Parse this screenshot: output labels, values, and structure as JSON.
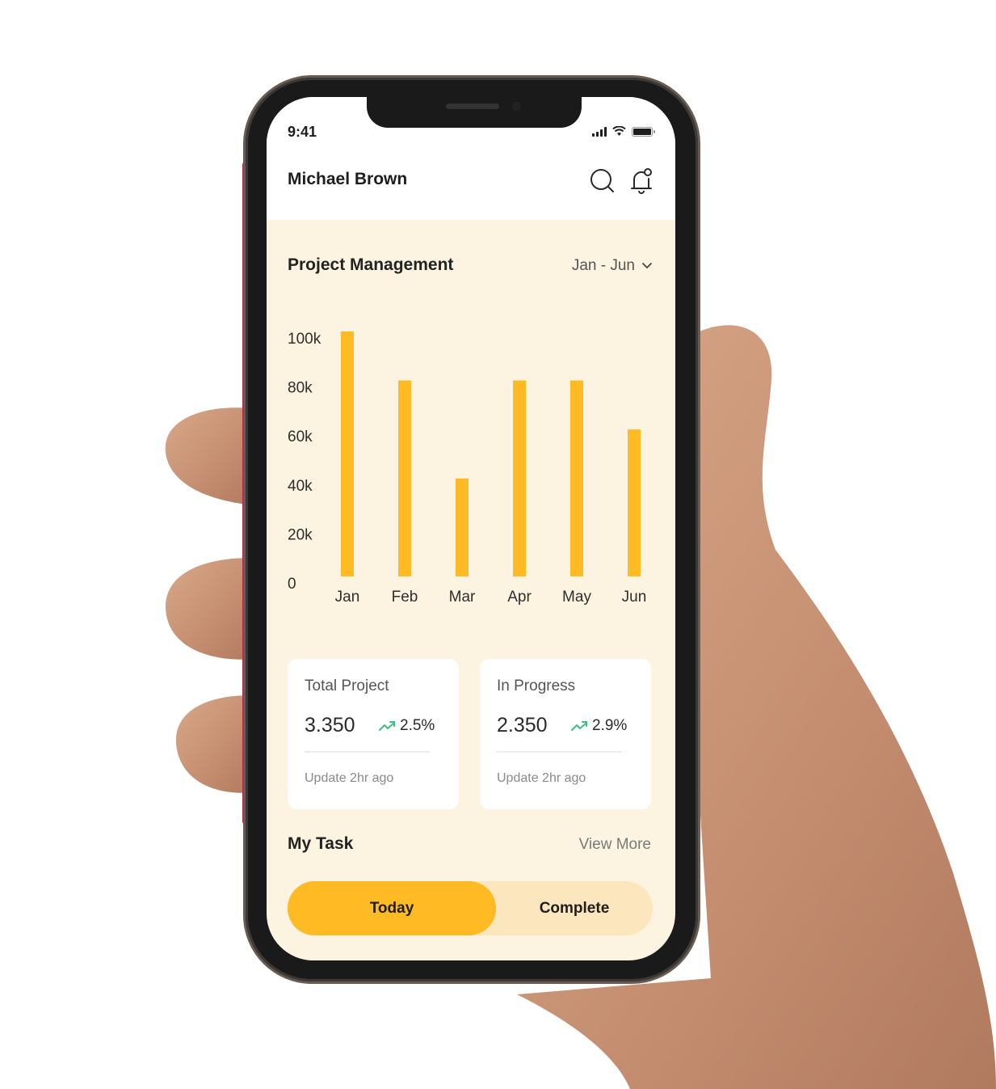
{
  "status_bar": {
    "time": "9:41"
  },
  "header": {
    "user_name": "Michael Brown",
    "icons": [
      "search-icon",
      "bell-icon"
    ]
  },
  "project_section": {
    "title": "Project Management",
    "range": "Jan - Jun"
  },
  "chart_data": {
    "type": "bar",
    "title": "Project Management",
    "categories": [
      "Jan",
      "Feb",
      "Mar",
      "Apr",
      "May",
      "Jun"
    ],
    "values": [
      100000,
      80000,
      40000,
      80000,
      80000,
      60000
    ],
    "yticks": [
      "0",
      "20k",
      "40k",
      "60k",
      "80k",
      "100k"
    ],
    "ylim": [
      0,
      100000
    ],
    "xlabel": "",
    "ylabel": "",
    "grid": false,
    "bar_color": "#ffba24"
  },
  "stats": [
    {
      "label": "Total Project",
      "value": "3.350",
      "change": "2.5%",
      "trend": "up",
      "updated": "Update 2hr ago"
    },
    {
      "label": "In Progress",
      "value": "2.350",
      "change": "2.9%",
      "trend": "up",
      "updated": "Update 2hr ago"
    }
  ],
  "tasks": {
    "title": "My Task",
    "view_more": "View More",
    "tabs": [
      {
        "label": "Today",
        "active": true
      },
      {
        "label": "Complete",
        "active": false
      }
    ]
  },
  "colors": {
    "accent": "#ffba24",
    "background": "#fcf3e0",
    "toggle_bg": "#fbe6bd",
    "trend_up": "#3fbf7f"
  }
}
